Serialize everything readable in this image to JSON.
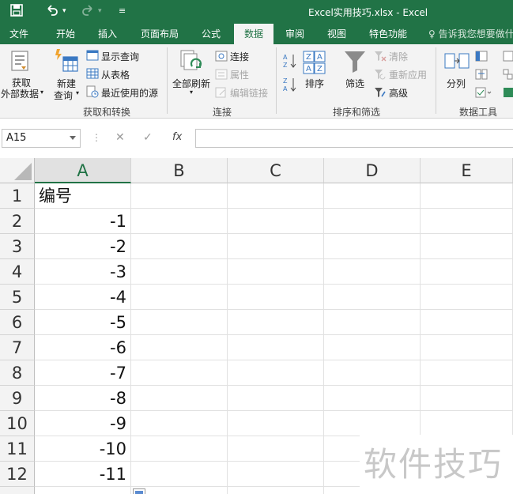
{
  "window": {
    "title": "Excel实用技巧.xlsx - Excel",
    "quick_access": {
      "save_icon": "save-icon",
      "undo_icon": "undo-icon",
      "redo_icon": "redo-icon",
      "customize_icon": "customize-icon"
    }
  },
  "tabs": [
    "文件",
    "开始",
    "插入",
    "页面布局",
    "公式",
    "数据",
    "审阅",
    "视图",
    "特色功能"
  ],
  "active_tab": "数据",
  "tell_me": "告诉我您想要做什",
  "ribbon": {
    "get_external": {
      "line1": "获取",
      "line2": "外部数据"
    },
    "new_query": {
      "line1": "新建",
      "line2": "查询"
    },
    "show_queries": "显示查询",
    "from_table": "从表格",
    "recent_sources": "最近使用的源",
    "group_get_transform": "获取和转换",
    "refresh_all": "全部刷新",
    "connections": "连接",
    "properties": "属性",
    "edit_links": "编辑链接",
    "group_connections": "连接",
    "sort": "排序",
    "filter": "筛选",
    "clear": "清除",
    "reapply": "重新应用",
    "advanced": "高级",
    "group_sort_filter": "排序和筛选",
    "text_to_columns": "分列",
    "group_data_tools": "数据工具"
  },
  "formula_bar": {
    "name_box": "A15",
    "cancel": "✕",
    "enter": "✓",
    "fx": "fx",
    "content": ""
  },
  "columns": [
    "A",
    "B",
    "C",
    "D",
    "E"
  ],
  "rows": [
    "1",
    "2",
    "3",
    "4",
    "5",
    "6",
    "7",
    "8",
    "9",
    "10",
    "11",
    "12"
  ],
  "cells": {
    "A1": "编号",
    "A2": "-1",
    "A3": "-2",
    "A4": "-3",
    "A5": "-4",
    "A6": "-5",
    "A7": "-6",
    "A8": "-7",
    "A9": "-8",
    "A10": "-9",
    "A11": "-10",
    "A12": "-11"
  },
  "watermark": "软件技巧",
  "colors": {
    "brand": "#217346",
    "ribbon_bg": "#f3f3f3",
    "header_bg": "#f3f3f3"
  }
}
